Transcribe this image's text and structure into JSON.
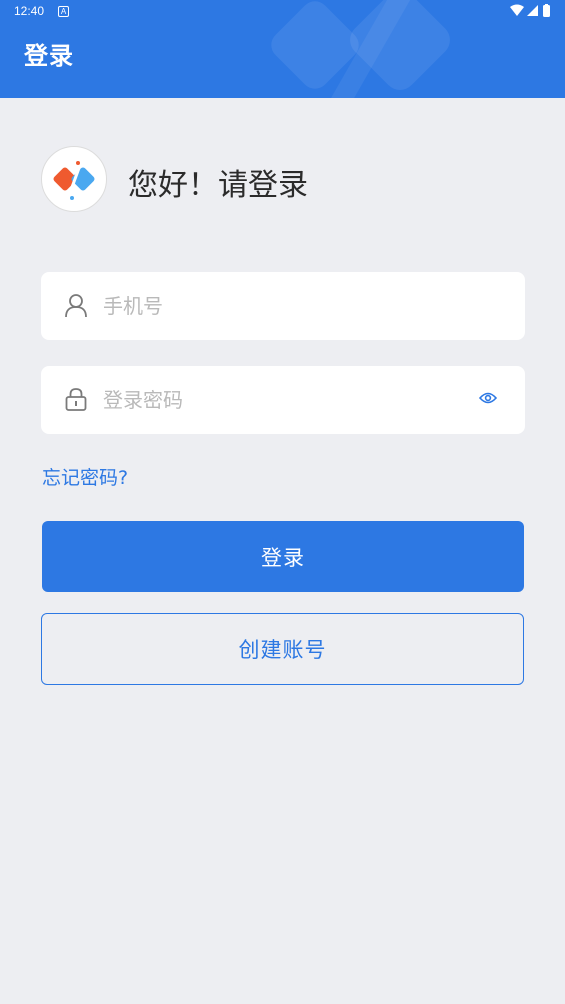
{
  "status_bar": {
    "time": "12:40",
    "notification_icon": "A"
  },
  "header": {
    "title": "登录"
  },
  "greeting": {
    "text": "您好！请登录"
  },
  "form": {
    "phone": {
      "placeholder": "手机号",
      "value": "",
      "icon": "person-icon"
    },
    "password": {
      "placeholder": "登录密码",
      "value": "",
      "icon": "lock-icon",
      "toggle_icon": "eye-icon"
    },
    "forgot_label": "忘记密码?"
  },
  "actions": {
    "login_label": "登录",
    "register_label": "创建账号"
  },
  "colors": {
    "accent": "#2d78e3",
    "background": "#edeef2"
  }
}
